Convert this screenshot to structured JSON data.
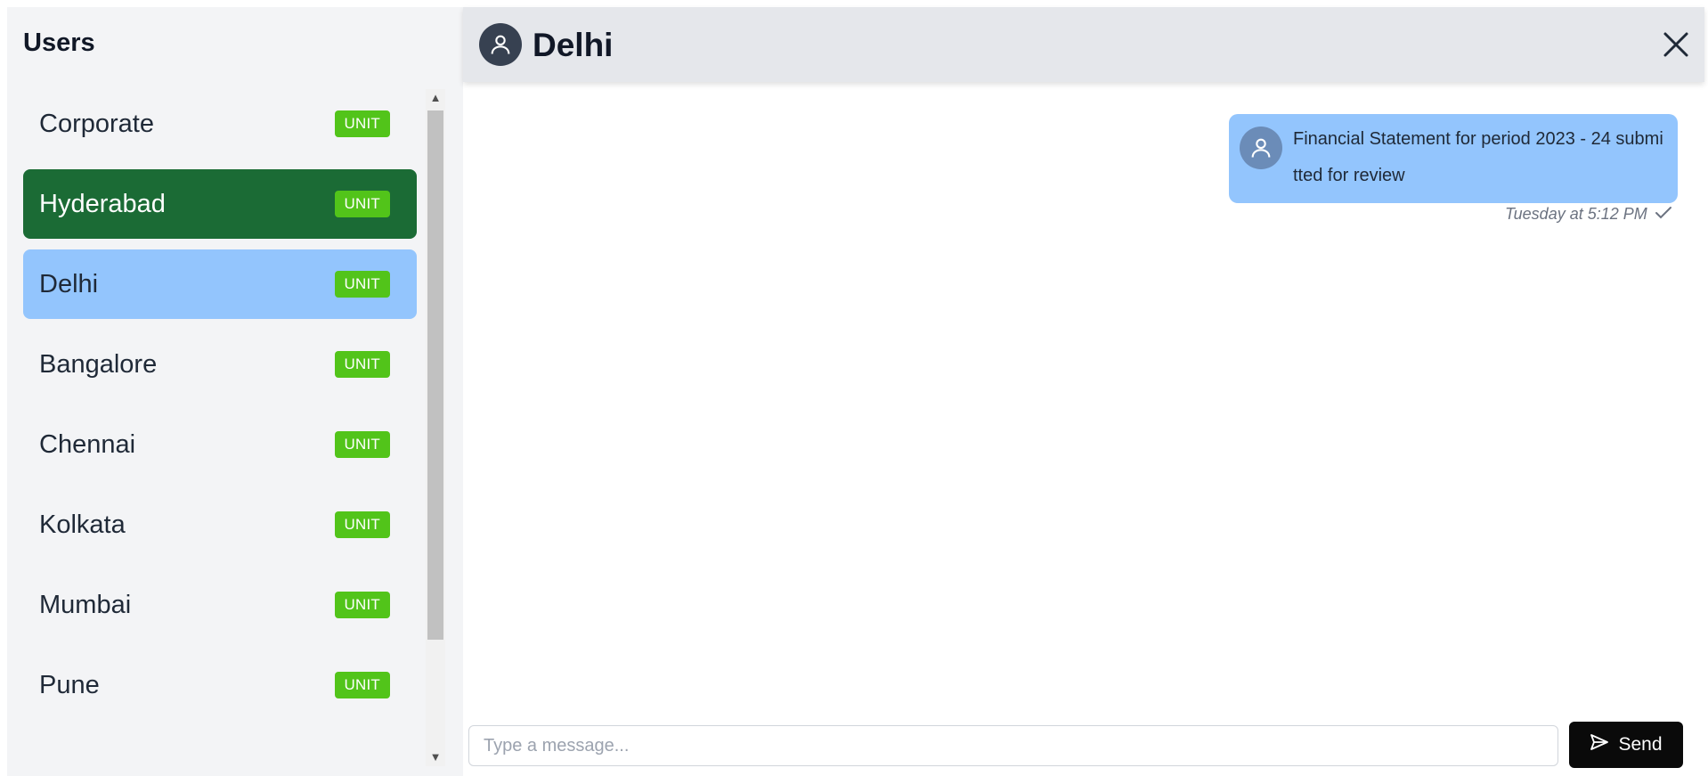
{
  "sidebar": {
    "title": "Users",
    "items": [
      {
        "label": "Corporate",
        "badge": "UNIT",
        "state": "normal"
      },
      {
        "label": "Hyderabad",
        "badge": "UNIT",
        "state": "selected"
      },
      {
        "label": "Delhi",
        "badge": "UNIT",
        "state": "active"
      },
      {
        "label": "Bangalore",
        "badge": "UNIT",
        "state": "normal"
      },
      {
        "label": "Chennai",
        "badge": "UNIT",
        "state": "normal"
      },
      {
        "label": "Kolkata",
        "badge": "UNIT",
        "state": "normal"
      },
      {
        "label": "Mumbai",
        "badge": "UNIT",
        "state": "normal"
      },
      {
        "label": "Pune",
        "badge": "UNIT",
        "state": "normal"
      }
    ]
  },
  "chat": {
    "title": "Delhi",
    "messages": [
      {
        "text": "Financial Statement for period 2023 - 24 submitted for review",
        "timestamp": "Tuesday at 5:12 PM",
        "status_icon": "check-icon"
      }
    ]
  },
  "composer": {
    "placeholder": "Type a message...",
    "send_label": "Send"
  },
  "colors": {
    "selected_bg": "#1b6b35",
    "active_bg": "#93c5fd",
    "badge_bg": "#52c41a",
    "send_bg": "#0a0a0a"
  }
}
